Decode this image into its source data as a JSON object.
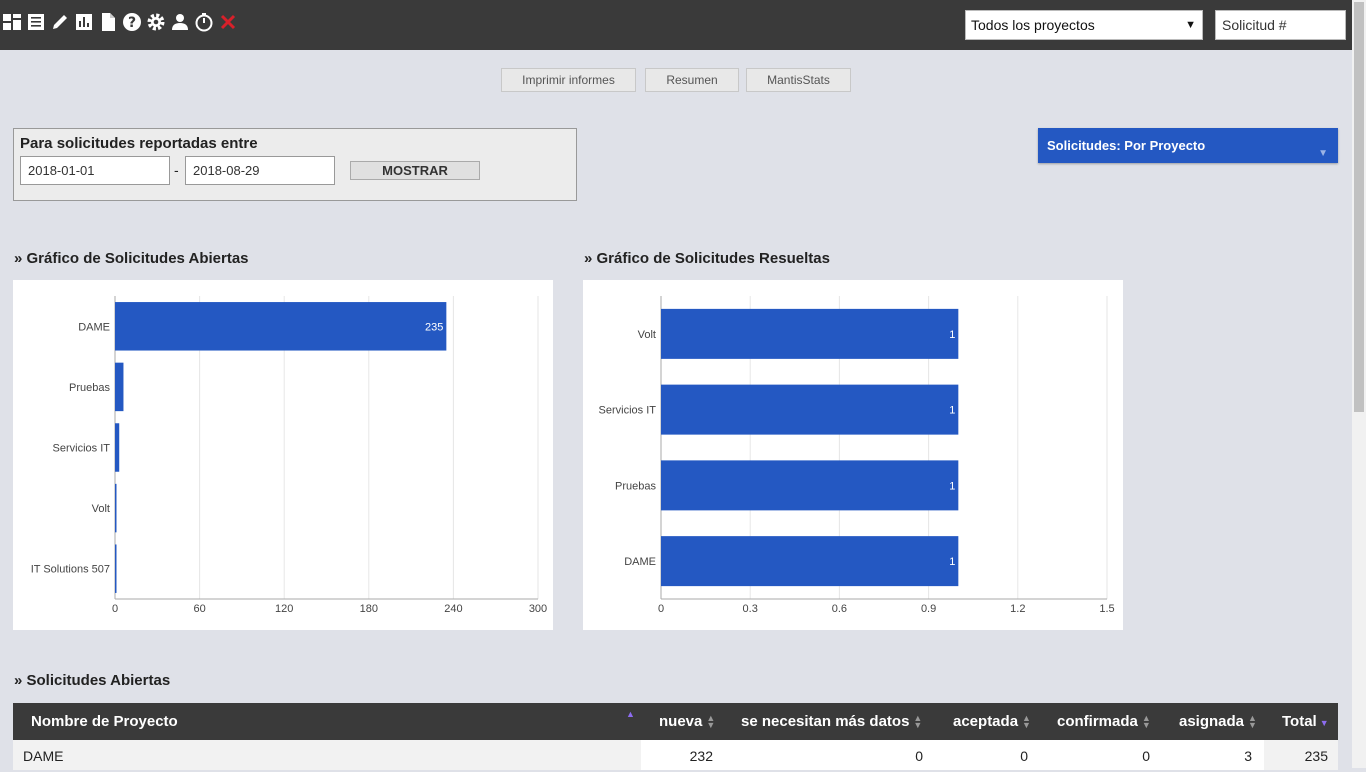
{
  "topbar": {
    "icons": [
      "dashboard-icon",
      "list-icon",
      "edit-icon",
      "bar-chart-icon",
      "document-icon",
      "help-icon",
      "settings-icon",
      "user-icon",
      "timer-icon",
      "close-icon"
    ],
    "project_select": "Todos los proyectos",
    "ticket_placeholder": "Solicitud #"
  },
  "tabs": [
    "Imprimir informes",
    "Resumen",
    "MantisStats"
  ],
  "filter": {
    "title": "Para solicitudes reportadas entre",
    "date_from": "2018-01-01",
    "separator": "-",
    "date_to": "2018-08-29",
    "show_label": "MOSTRAR"
  },
  "widget": {
    "title": "Solicitudes: Por Proyecto"
  },
  "sections": {
    "open_chart_title": "» Gráfico de Solicitudes Abiertas",
    "resolved_chart_title": "» Gráfico de Solicitudes Resueltas",
    "open_table_title": "» Solicitudes Abiertas"
  },
  "chart_data": [
    {
      "type": "bar",
      "orientation": "horizontal",
      "categories": [
        "DAME",
        "Pruebas",
        "Servicios IT",
        "Volt",
        "IT Solutions 507"
      ],
      "values": [
        235,
        6,
        3,
        1,
        1
      ],
      "value_labels": [
        "235",
        "",
        "",
        "",
        ""
      ],
      "xlim": [
        0,
        300
      ],
      "xticks": [
        0,
        60,
        120,
        180,
        240,
        300
      ],
      "bar_color": "#2458c2",
      "grid": true
    },
    {
      "type": "bar",
      "orientation": "horizontal",
      "categories": [
        "Volt",
        "Servicios IT",
        "Pruebas",
        "DAME"
      ],
      "values": [
        1,
        1,
        1,
        1
      ],
      "value_labels": [
        "1",
        "1",
        "1",
        "1"
      ],
      "xlim": [
        0,
        1.5
      ],
      "xticks": [
        0,
        0.3,
        0.6,
        0.9,
        1.2,
        1.5
      ],
      "bar_color": "#2458c2",
      "grid": true
    }
  ],
  "table": {
    "headers": {
      "name": "Nombre de Proyecto",
      "nueva": "nueva",
      "mas_datos": "se necesitan más datos",
      "aceptada": "aceptada",
      "confirmada": "confirmada",
      "asignada": "asignada",
      "total": "Total"
    },
    "rows": [
      {
        "name": "DAME",
        "nueva": "232",
        "mas_datos": "0",
        "aceptada": "0",
        "confirmada": "0",
        "asignada": "3",
        "total": "235"
      }
    ]
  }
}
